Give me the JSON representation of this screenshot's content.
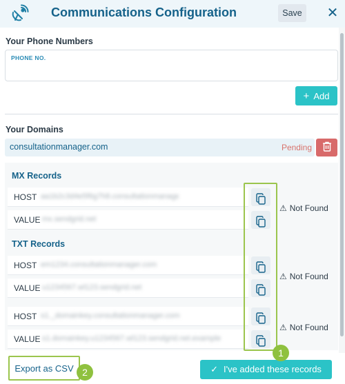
{
  "header": {
    "title": "Communications Configuration",
    "save_label": "Save",
    "close_glyph": "✕",
    "icon": "satellite-dish-icon"
  },
  "phones": {
    "section_label": "Your Phone Numbers",
    "field_label": "PHONE NO.",
    "value": "",
    "add_label": "Add"
  },
  "domains": {
    "section_label": "Your Domains",
    "items": [
      {
        "name": "consultationmanager.com",
        "status": "Pending"
      }
    ]
  },
  "mx": {
    "title": "MX Records",
    "host_label": "HOST",
    "host_value": "aa1b2c3d4e5f6g7h8.consultationmanager.com",
    "value_label": "VALUE",
    "value_value": "mx.sendgrid.net",
    "status": "Not Found"
  },
  "txt": {
    "title": "TXT Records",
    "rec1": {
      "host_label": "HOST",
      "host_value": "em1234.consultationmanager.com",
      "value_label": "VALUE",
      "value_value": "u1234567.wl123.sendgrid.net",
      "status": "Not Found"
    },
    "rec2": {
      "host_label": "HOST",
      "host_value": "s1._domainkey.consultationmanager.com",
      "value_label": "VALUE",
      "value_value": "s1.domainkey.u1234567.wl123.sendgrid.net.example",
      "status": "Not Found"
    }
  },
  "footer": {
    "export_label": "Export as CSV",
    "confirm_label": "I've added these records"
  },
  "badges": {
    "one": "1",
    "two": "2"
  },
  "colors": {
    "accent": "#2bc3c7",
    "brand": "#15628a",
    "danger": "#d86a6a",
    "highlight": "#9bc54d"
  }
}
